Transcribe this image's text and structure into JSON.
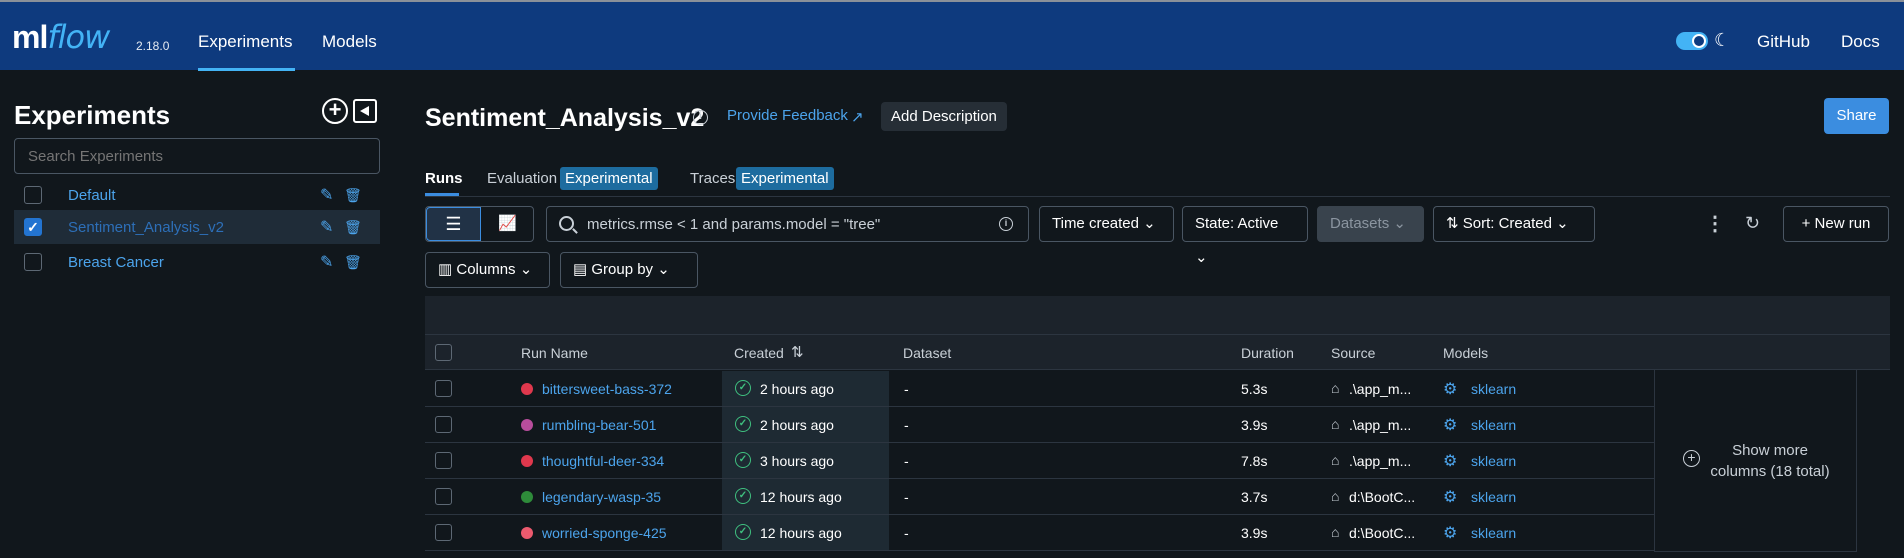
{
  "nav": {
    "logo_ml": "ml",
    "logo_flow": "flow",
    "version": "2.18.0",
    "experiments": "Experiments",
    "models": "Models",
    "github": "GitHub",
    "docs": "Docs"
  },
  "sidebar": {
    "title": "Experiments",
    "search_placeholder": "Search Experiments",
    "items": [
      {
        "label": "Default",
        "checked": false
      },
      {
        "label": "Sentiment_Analysis_v2",
        "checked": true
      },
      {
        "label": "Breast Cancer",
        "checked": false
      }
    ]
  },
  "experiment": {
    "title": "Sentiment_Analysis_v2",
    "feedback": "Provide Feedback",
    "add_description": "Add Description",
    "share": "Share"
  },
  "tabs": {
    "runs": "Runs",
    "evaluation": "Evaluation",
    "evaluation_badge": "Experimental",
    "traces": "Traces",
    "traces_badge": "Experimental"
  },
  "toolbar": {
    "search_text": "metrics.rmse < 1 and params.model = \"tree\"",
    "time_created": "Time created",
    "state": "State: Active",
    "datasets": "Datasets",
    "sort": "Sort: Created",
    "new_run": "New run",
    "columns": "Columns",
    "group_by": "Group by"
  },
  "table": {
    "headers": {
      "run_name": "Run Name",
      "created": "Created",
      "dataset": "Dataset",
      "duration": "Duration",
      "source": "Source",
      "models": "Models"
    },
    "rows": [
      {
        "name": "bittersweet-bass-372",
        "color": "#e0384d",
        "created": "2 hours ago",
        "dataset": "-",
        "duration": "5.3s",
        "source": ".\\app_m...",
        "model": "sklearn"
      },
      {
        "name": "rumbling-bear-501",
        "color": "#b84d9c",
        "created": "2 hours ago",
        "dataset": "-",
        "duration": "3.9s",
        "source": ".\\app_m...",
        "model": "sklearn"
      },
      {
        "name": "thoughtful-deer-334",
        "color": "#e0384d",
        "created": "3 hours ago",
        "dataset": "-",
        "duration": "7.8s",
        "source": ".\\app_m...",
        "model": "sklearn"
      },
      {
        "name": "legendary-wasp-35",
        "color": "#2e8b3a",
        "created": "12 hours ago",
        "dataset": "-",
        "duration": "3.7s",
        "source": "d:\\BootC...",
        "model": "sklearn"
      },
      {
        "name": "worried-sponge-425",
        "color": "#ec5a6e",
        "created": "12 hours ago",
        "dataset": "-",
        "duration": "3.9s",
        "source": "d:\\BootC...",
        "model": "sklearn"
      }
    ],
    "show_more": "Show more columns (18 total)"
  }
}
